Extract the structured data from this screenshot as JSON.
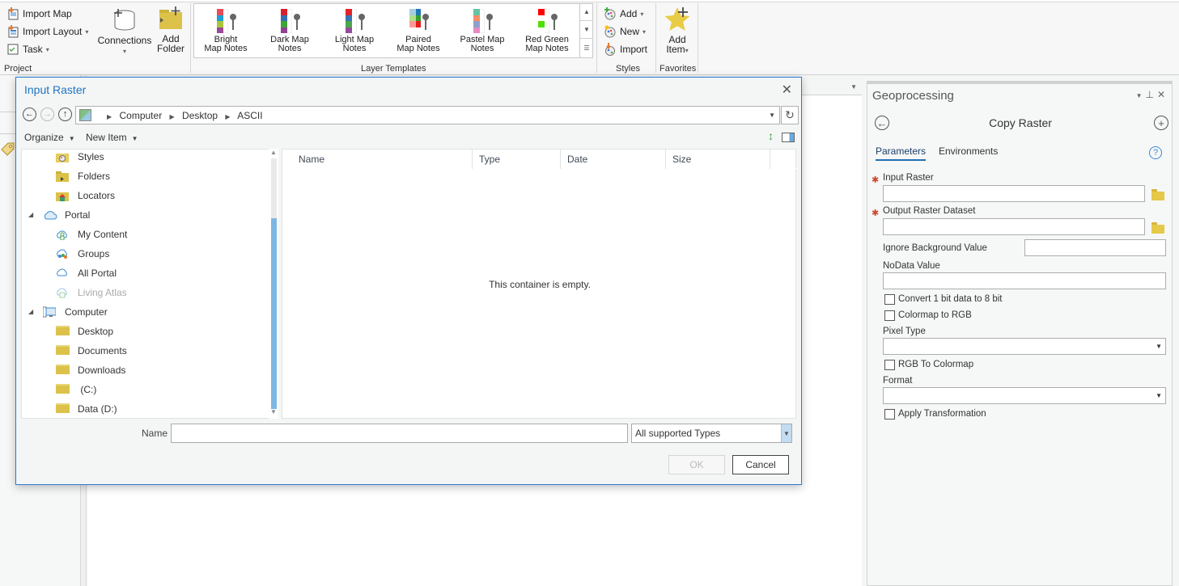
{
  "ribbon": {
    "project": {
      "import_map": "Import Map",
      "import_layout": "Import Layout",
      "task": "Task",
      "connections": "Connections",
      "add_folder_line1": "Add",
      "add_folder_line2": "Folder",
      "group_label": "Project"
    },
    "layer_templates": {
      "group_label": "Layer Templates",
      "items": [
        {
          "line1": "Bright",
          "line2": "Map Notes",
          "colors": [
            "#e84c57",
            "#1d9fd8",
            "#a9c53a",
            "#9a4b98"
          ],
          "side": []
        },
        {
          "line1": "Dark Map",
          "line2": "Notes",
          "colors": [
            "#d8202a",
            "#356fb1",
            "#41a23a",
            "#8d4393"
          ],
          "side": []
        },
        {
          "line1": "Light Map",
          "line2": "Notes",
          "colors": [
            "#e1232a",
            "#3a73b4",
            "#4aa64a",
            "#944c98"
          ],
          "side": []
        },
        {
          "line1": "Paired",
          "line2": "Map Notes",
          "colors": [
            "#a6cee3",
            "#b2df8a",
            "#fb9a99",
            "#ffffff"
          ],
          "side": [
            "#1f78b4",
            "#33a02c",
            "#e31a1c",
            "#ffffff"
          ]
        },
        {
          "line1": "Pastel Map",
          "line2": "Notes",
          "colors": [
            "#66c2a5",
            "#fc8d62",
            "#8da0cb",
            "#e78ac3"
          ],
          "side": []
        },
        {
          "line1": "Red Green",
          "line2": "Map Notes",
          "colors": [
            "#ff0000",
            "#ffffff",
            "#4ee000",
            "#ffffff"
          ],
          "side": []
        }
      ]
    },
    "styles": {
      "add": "Add",
      "new": "New",
      "import": "Import",
      "group_label": "Styles"
    },
    "favorites": {
      "add_item_line1": "Add",
      "add_item_line2": "Item",
      "group_label": "Favorites"
    }
  },
  "dialog": {
    "title": "Input Raster",
    "breadcrumb": [
      "Computer",
      "Desktop",
      "ASCII"
    ],
    "toolbar": {
      "organize": "Organize",
      "new_item": "New Item"
    },
    "tree": [
      {
        "label": "Styles",
        "icon": "styles-folder-icon",
        "level": 1
      },
      {
        "label": "Folders",
        "icon": "folders-icon",
        "level": 1
      },
      {
        "label": "Locators",
        "icon": "locators-icon",
        "level": 1
      },
      {
        "label": "Portal",
        "icon": "portal-cloud-icon",
        "level": 0,
        "expanded": true
      },
      {
        "label": "My Content",
        "icon": "my-content-icon",
        "level": 1
      },
      {
        "label": "Groups",
        "icon": "groups-icon",
        "level": 1
      },
      {
        "label": "All Portal",
        "icon": "all-portal-cloud-icon",
        "level": 1
      },
      {
        "label": "Living Atlas",
        "icon": "living-atlas-icon",
        "level": 1,
        "disabled": true
      },
      {
        "label": "Computer",
        "icon": "computer-icon",
        "level": 0,
        "expanded": true
      },
      {
        "label": "Desktop",
        "icon": "folder-icon",
        "level": 1
      },
      {
        "label": "Documents",
        "icon": "folder-icon",
        "level": 1
      },
      {
        "label": "Downloads",
        "icon": "folder-icon",
        "level": 1
      },
      {
        "label": " (C:)",
        "icon": "folder-icon",
        "level": 1
      },
      {
        "label": "Data (D:)",
        "icon": "folder-icon",
        "level": 1
      }
    ],
    "columns": [
      "Name",
      "Type",
      "Date",
      "Size"
    ],
    "empty_message": "This container is empty.",
    "name_label": "Name",
    "name_value": "",
    "type_filter": "All supported Types",
    "ok": "OK",
    "cancel": "Cancel"
  },
  "geoprocessing": {
    "pane_title": "Geoprocessing",
    "tool_title": "Copy Raster",
    "tabs": [
      "Parameters",
      "Environments"
    ],
    "params": {
      "input_raster": "Input Raster",
      "output_raster": "Output Raster Dataset",
      "ignore_bg": "Ignore Background Value",
      "nodata": "NoData Value",
      "convert_1bit": "Convert 1 bit data to 8 bit",
      "colormap_rgb": "Colormap to RGB",
      "pixel_type": "Pixel Type",
      "rgb_colormap": "RGB To Colormap",
      "format": "Format",
      "apply_transform": "Apply Transformation"
    },
    "values": {
      "input_raster": "",
      "output_raster": "",
      "ignore_bg": "",
      "nodata": "",
      "pixel_type": "",
      "format": ""
    },
    "checks": {
      "convert_1bit": false,
      "colormap_rgb": false,
      "rgb_colormap": false,
      "apply_transform": false
    }
  }
}
